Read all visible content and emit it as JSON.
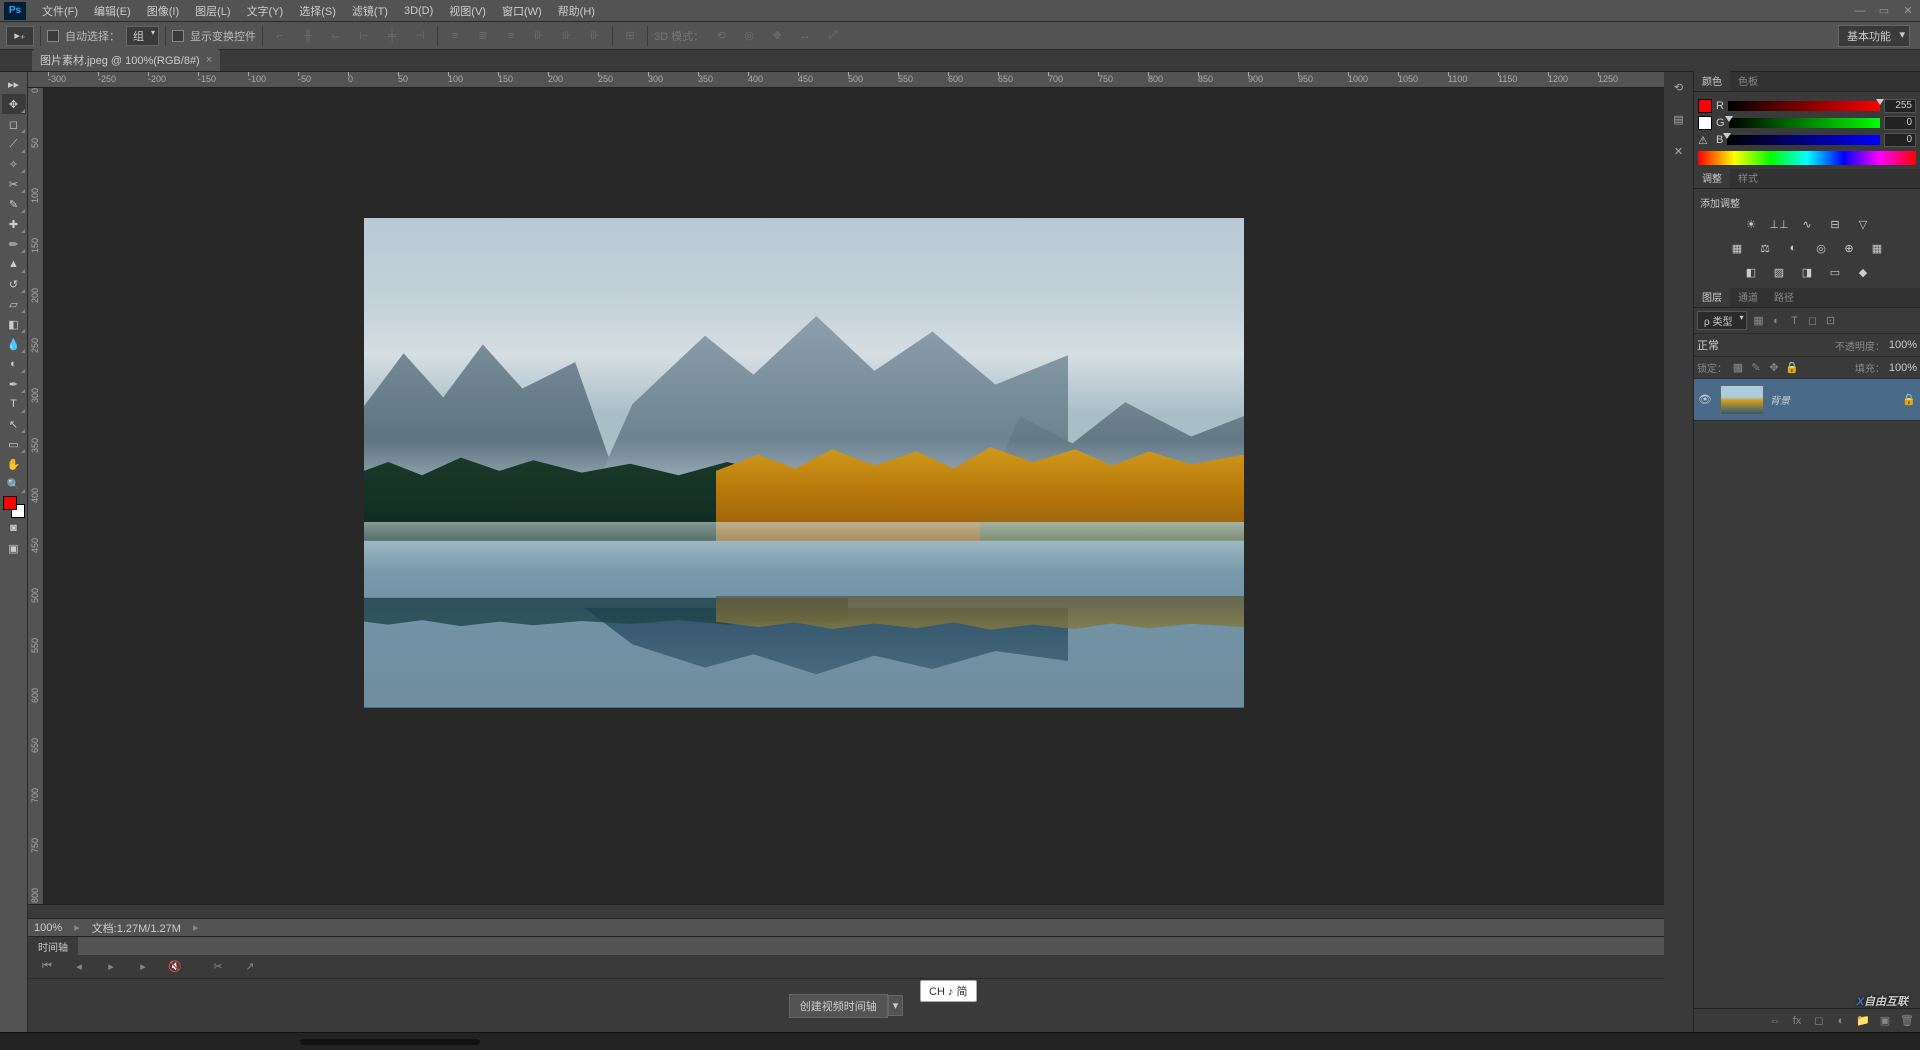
{
  "menubar": [
    "文件(F)",
    "编辑(E)",
    "图像(I)",
    "图层(L)",
    "文字(Y)",
    "选择(S)",
    "滤镜(T)",
    "3D(D)",
    "视图(V)",
    "窗口(W)",
    "帮助(H)"
  ],
  "options": {
    "auto_select": "自动选择：",
    "group": "组",
    "show_transform": "显示变换控件",
    "mode_3d": "3D 模式："
  },
  "workspace_label": "基本功能",
  "tab": {
    "title": "图片素材.jpeg @ 100%(RGB/8#)"
  },
  "ruler_h": [
    "-300",
    "-250",
    "-200",
    "-150",
    "-100",
    "-50",
    "0",
    "50",
    "100",
    "150",
    "200",
    "250",
    "300",
    "350",
    "400",
    "450",
    "500",
    "550",
    "600",
    "650",
    "700",
    "750",
    "800",
    "850",
    "900",
    "950",
    "1000",
    "1050",
    "1100",
    "1150",
    "1200",
    "1250"
  ],
  "ruler_v": [
    "0",
    "50",
    "100",
    "150",
    "200",
    "250",
    "300",
    "350",
    "400",
    "450",
    "500",
    "550",
    "600",
    "650",
    "700",
    "750",
    "800"
  ],
  "status": {
    "zoom": "100%",
    "doc": "文档:1.27M/1.27M"
  },
  "timeline": {
    "tab": "时间轴",
    "create_video": "创建视频时间轴"
  },
  "ime": "CH ♪ 简",
  "panels": {
    "color": {
      "tabs": [
        "颜色",
        "色板"
      ],
      "r_lbl": "R",
      "g_lbl": "G",
      "b_lbl": "B",
      "r": "255",
      "g": "0",
      "b": "0"
    },
    "adjustments": {
      "tabs": [
        "调整",
        "样式"
      ],
      "title": "添加调整"
    },
    "layers": {
      "tabs": [
        "图层",
        "通道",
        "路径"
      ],
      "filter": "ρ 类型",
      "blend": "正常",
      "opacity_lbl": "不透明度：",
      "opacity": "100%",
      "lock_lbl": "锁定：",
      "fill_lbl": "填充：",
      "fill": "100%",
      "layer0": "背景"
    }
  },
  "watermark": "自由互联"
}
